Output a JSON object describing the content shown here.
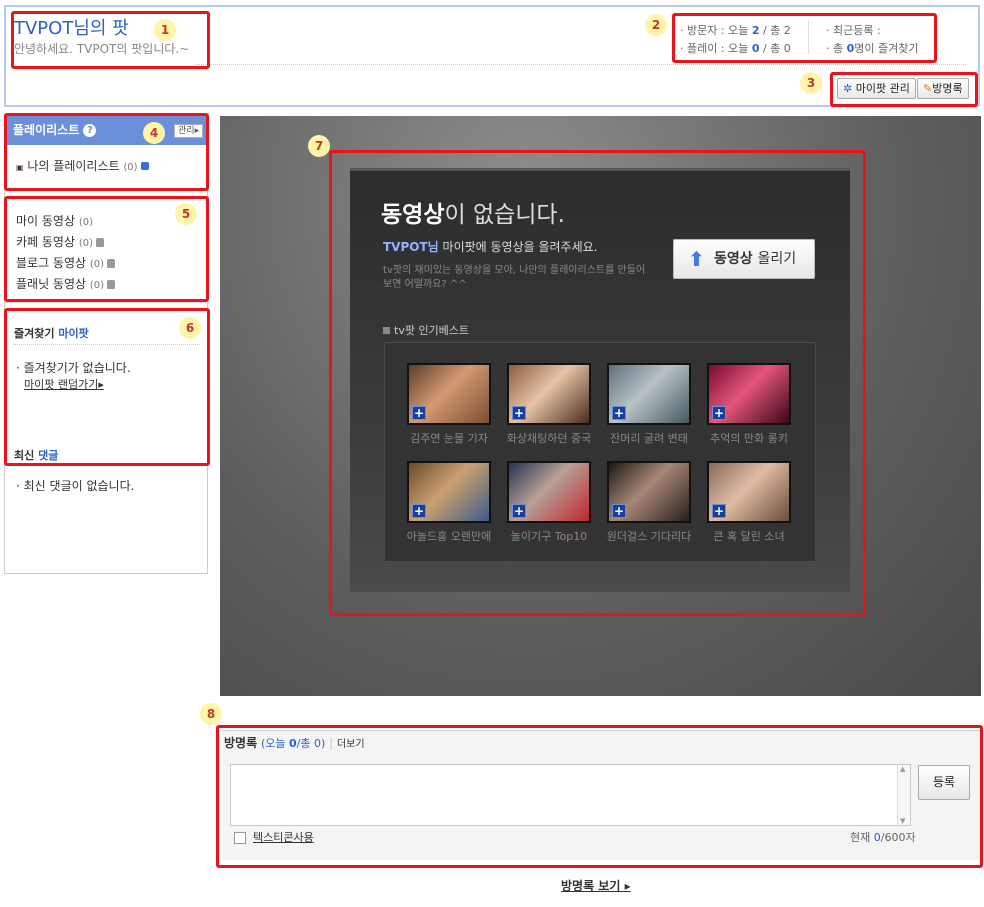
{
  "header": {
    "title": "TVPOT님의 팟",
    "greeting": "안녕하세요. TVPOT의 팟입니다.~",
    "visitors_label": "방문자 : 오늘",
    "visitors_today": "2",
    "visitors_total_label": "/ 총 2",
    "plays_label": "플레이 : 오늘",
    "plays_today": "0",
    "plays_total_label": "/ 총 0",
    "recent_label": "최근등록 :",
    "fav_prefix": "총",
    "fav_count": "0",
    "fav_suffix": "명이 즐겨찾기",
    "manage_button": "마이팟 관리",
    "guestbook_button": "방명록"
  },
  "sidebar": {
    "playlist_title": "플레이리스트",
    "manage_label": "관리",
    "my_playlist": "나의 플레이리스트",
    "my_playlist_count": "(0)",
    "video_links": [
      {
        "label": "마이 동영상",
        "count": "(0)"
      },
      {
        "label": "카페 동영상",
        "count": "(0)"
      },
      {
        "label": "블로그 동영상",
        "count": "(0)"
      },
      {
        "label": "플래닛 동영상",
        "count": "(0)"
      }
    ],
    "favorites_title": "즐겨찾기",
    "favorites_title_accent": "마이팟",
    "favorites_empty": "즐겨찾기가 없습니다.",
    "random_link": "마이팟 랜덤가기",
    "comments_title": "최신",
    "comments_title_accent": "댓글",
    "comments_empty": "최신 댓글이 없습니다."
  },
  "main": {
    "no_video_bold": "동영상",
    "no_video_rest": "이 없습니다.",
    "owner": "TVPOT님",
    "prompt": "마이팟에 동영상을 올려주세요.",
    "desc_line1": "tv팟의 재미있는 동영상을 모아, 나만의 플레이리스트를 만들어",
    "desc_line2": "보면 어떨까요? ^^",
    "upload_bold": "동영상",
    "upload_rest": "올리기",
    "best_title": "tv팟 인기베스트",
    "videos": [
      {
        "caption": "김주연 눈물 기자"
      },
      {
        "caption": "화상채팅하던 중국"
      },
      {
        "caption": "잔머리 굴려 변태"
      },
      {
        "caption": "추억의 만화 롱키"
      },
      {
        "caption": "아놀드홍 오랜만에"
      },
      {
        "caption": "놀이기구 Top10"
      },
      {
        "caption": "원더걸스 기다리다"
      },
      {
        "caption": "큰 혹 달린 소녀"
      }
    ]
  },
  "guestbook": {
    "title": "방명록",
    "stats_open": "(오늘",
    "today": "0",
    "stats_close": "/총 0)",
    "more": "더보기",
    "submit": "등록",
    "emoticon_label": "텍스티콘사용",
    "counter_prefix": "현재",
    "counter_value": "0",
    "counter_suffix": "/600자",
    "view_link": "방명록 보기"
  },
  "annotations": [
    "1",
    "2",
    "3",
    "4",
    "5",
    "6",
    "7",
    "8"
  ]
}
